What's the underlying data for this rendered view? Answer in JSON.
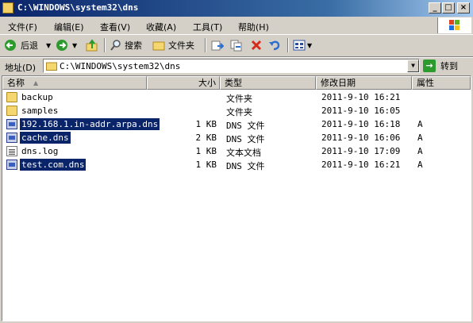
{
  "window": {
    "title": "C:\\WINDOWS\\system32\\dns"
  },
  "menu": [
    "文件(F)",
    "编辑(E)",
    "查看(V)",
    "收藏(A)",
    "工具(T)",
    "帮助(H)"
  ],
  "toolbar": {
    "back_label": "后退",
    "search_label": "搜索",
    "folders_label": "文件夹"
  },
  "address": {
    "label": "地址(D)",
    "value": "C:\\WINDOWS\\system32\\dns",
    "go_label": "转到"
  },
  "columns": {
    "name": "名称",
    "size": "大小",
    "type": "类型",
    "modified": "修改日期",
    "attributes": "属性"
  },
  "files": [
    {
      "name": "backup",
      "size": "",
      "type": "文件夹",
      "modified": "2011-9-10 16:21",
      "attr": "",
      "icon": "folder-icon",
      "selected": false
    },
    {
      "name": "samples",
      "size": "",
      "type": "文件夹",
      "modified": "2011-9-10 16:05",
      "attr": "",
      "icon": "folder-icon",
      "selected": false
    },
    {
      "name": "192.168.1.in-addr.arpa.dns",
      "size": "1 KB",
      "type": "DNS 文件",
      "modified": "2011-9-10 16:18",
      "attr": "A",
      "icon": "dns-file-icon",
      "selected": true
    },
    {
      "name": "cache.dns",
      "size": "2 KB",
      "type": "DNS 文件",
      "modified": "2011-9-10 16:06",
      "attr": "A",
      "icon": "dns-file-icon",
      "selected": true
    },
    {
      "name": "dns.log",
      "size": "1 KB",
      "type": "文本文档",
      "modified": "2011-9-10 17:09",
      "attr": "A",
      "icon": "text-file-icon",
      "selected": false
    },
    {
      "name": "test.com.dns",
      "size": "1 KB",
      "type": "DNS 文件",
      "modified": "2011-9-10 16:21",
      "attr": "A",
      "icon": "dns-file-icon",
      "selected": true
    }
  ]
}
